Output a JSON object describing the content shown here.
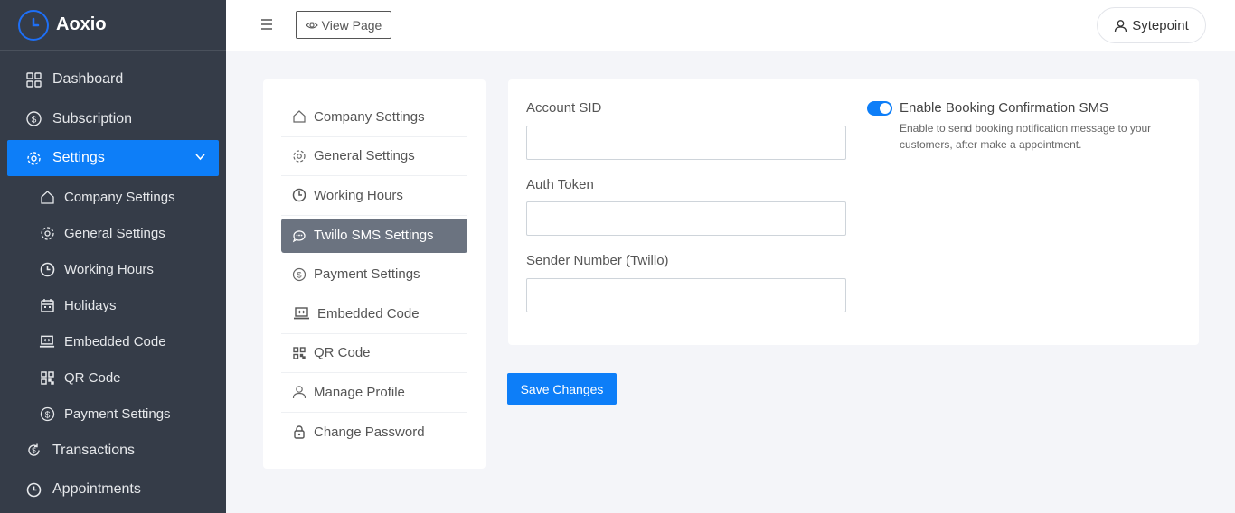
{
  "brand": {
    "name": "Aoxio"
  },
  "sidebar": {
    "items": [
      {
        "label": "Dashboard",
        "icon": "grid-icon"
      },
      {
        "label": "Subscription",
        "icon": "dollar-circle-icon"
      },
      {
        "label": "Settings",
        "icon": "gear-icon",
        "active": true
      },
      {
        "label": "Transactions",
        "icon": "cycle-dollar-icon"
      },
      {
        "label": "Appointments",
        "icon": "clock-icon"
      }
    ],
    "sub_items": [
      {
        "label": "Company Settings",
        "icon": "home-icon"
      },
      {
        "label": "General Settings",
        "icon": "gear-icon"
      },
      {
        "label": "Working Hours",
        "icon": "clock-icon"
      },
      {
        "label": "Holidays",
        "icon": "calendar-icon"
      },
      {
        "label": "Embedded Code",
        "icon": "laptop-code-icon"
      },
      {
        "label": "QR Code",
        "icon": "qr-icon"
      },
      {
        "label": "Payment Settings",
        "icon": "dollar-circle-icon"
      }
    ]
  },
  "topbar": {
    "view_page_label": "View Page",
    "user_name": "Sytepoint"
  },
  "settings_menu": {
    "items": [
      {
        "label": "Company Settings",
        "icon": "home-icon"
      },
      {
        "label": "General Settings",
        "icon": "gear-icon"
      },
      {
        "label": "Working Hours",
        "icon": "clock-icon"
      },
      {
        "label": "Twillo SMS Settings",
        "icon": "chat-icon",
        "active": true
      },
      {
        "label": "Payment Settings",
        "icon": "dollar-circle-icon"
      },
      {
        "label": "Embedded Code",
        "icon": "laptop-code-icon"
      },
      {
        "label": "QR Code",
        "icon": "qr-icon"
      },
      {
        "label": "Manage Profile",
        "icon": "user-icon"
      },
      {
        "label": "Change Password",
        "icon": "lock-icon"
      }
    ]
  },
  "form": {
    "account_sid_label": "Account SID",
    "account_sid_value": "",
    "auth_token_label": "Auth Token",
    "auth_token_value": "",
    "sender_number_label": "Sender Number (Twillo)",
    "sender_number_value": "",
    "toggle_title": "Enable Booking Confirmation SMS",
    "toggle_desc": "Enable to send booking notification message to your customers, after make a appointment.",
    "toggle_on": true,
    "save_label": "Save Changes"
  },
  "colors": {
    "sidebar_bg": "#353c48",
    "accent": "#0d7ef8",
    "menu_active_bg": "#6b7380"
  }
}
